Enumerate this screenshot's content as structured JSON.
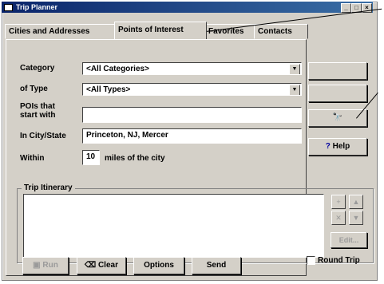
{
  "window": {
    "title": "Trip Planner"
  },
  "tabs": [
    {
      "label": "Cities and Addresses"
    },
    {
      "label": "Points of Interest"
    },
    {
      "label": "Favorites"
    },
    {
      "label": "Contacts"
    }
  ],
  "form": {
    "category_label": "Category",
    "category_value": "<All Categories>",
    "type_label": "of Type",
    "type_value": "<All Types>",
    "pois_label_1": "POIs that",
    "pois_label_2": "start with",
    "pois_value": "",
    "city_label": "In City/State",
    "city_value": "Princeton, NJ, Mercer",
    "within_label": "Within",
    "within_value": "10",
    "within_suffix": "miles of the city"
  },
  "right_buttons": {
    "help_label": "Help",
    "help_icon": "question-icon",
    "find_icon": "binoculars-icon"
  },
  "itinerary": {
    "title": "Trip Itinerary",
    "edit_label": "Edit..."
  },
  "bottom_buttons": {
    "run_label": "Run",
    "clear_label": "Clear",
    "options_label": "Options",
    "send_label": "Send"
  },
  "round_trip": {
    "label": "Round Trip",
    "checked": false
  }
}
